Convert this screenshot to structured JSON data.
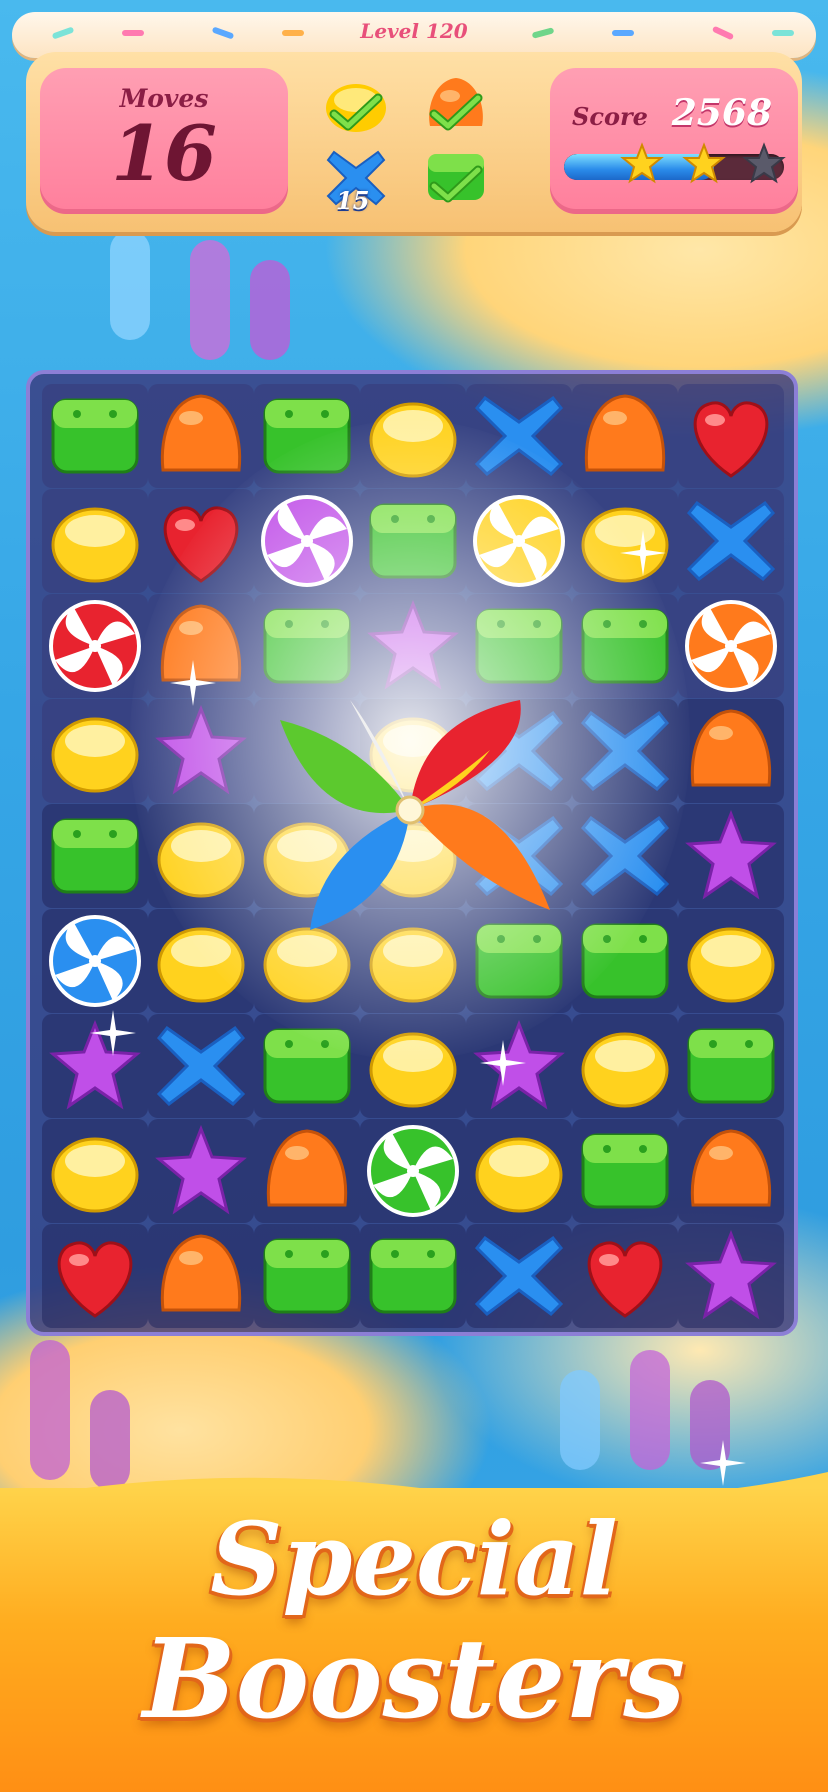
{
  "hud": {
    "level_label": "Level 120",
    "moves_label": "Moves",
    "moves_value": "16",
    "score_label": "Score",
    "score_value": "2568",
    "progress_fraction": 0.68,
    "stars_earned": 2,
    "stars_total": 3,
    "goals": [
      {
        "icon": "yellow-jelly-icon",
        "status": "done"
      },
      {
        "icon": "orange-gumdrop-icon",
        "status": "done"
      },
      {
        "icon": "blue-cross-candy-icon",
        "remaining": "15"
      },
      {
        "icon": "green-biscuit-icon",
        "status": "done"
      }
    ]
  },
  "board": {
    "columns": 7,
    "rows": 9,
    "grid": [
      [
        "green",
        "orange",
        "green",
        "yellow",
        "blue",
        "orange",
        "red"
      ],
      [
        "yellow",
        "red",
        "purple-swirl",
        "green",
        "yellow-swirl",
        "yellow",
        "blue"
      ],
      [
        "red-swirl",
        "orange",
        "green",
        "purple",
        "green",
        "green",
        "orange-swirl"
      ],
      [
        "yellow",
        "purple",
        "pinwheel",
        "yellow",
        "blue",
        "blue",
        "orange"
      ],
      [
        "green",
        "yellow",
        "yellow",
        "yellow",
        "blue",
        "blue",
        "purple"
      ],
      [
        "blue-swirl",
        "yellow",
        "yellow",
        "yellow",
        "green",
        "green",
        "yellow"
      ],
      [
        "purple",
        "blue",
        "green",
        "yellow",
        "purple",
        "yellow",
        "green"
      ],
      [
        "yellow",
        "purple",
        "orange",
        "green-swirl",
        "yellow",
        "green",
        "orange"
      ],
      [
        "red",
        "orange",
        "green",
        "green",
        "blue",
        "red",
        "purple"
      ]
    ],
    "booster": "pinwheel-icon"
  },
  "colors": {
    "red": "#e8232f",
    "orange": "#ff7a1c",
    "yellow": "#ffd21e",
    "green": "#37c22b",
    "blue": "#2a8ff0",
    "purple": "#c04fe8"
  },
  "footer": {
    "line1": "Special",
    "line2": "Boosters"
  }
}
